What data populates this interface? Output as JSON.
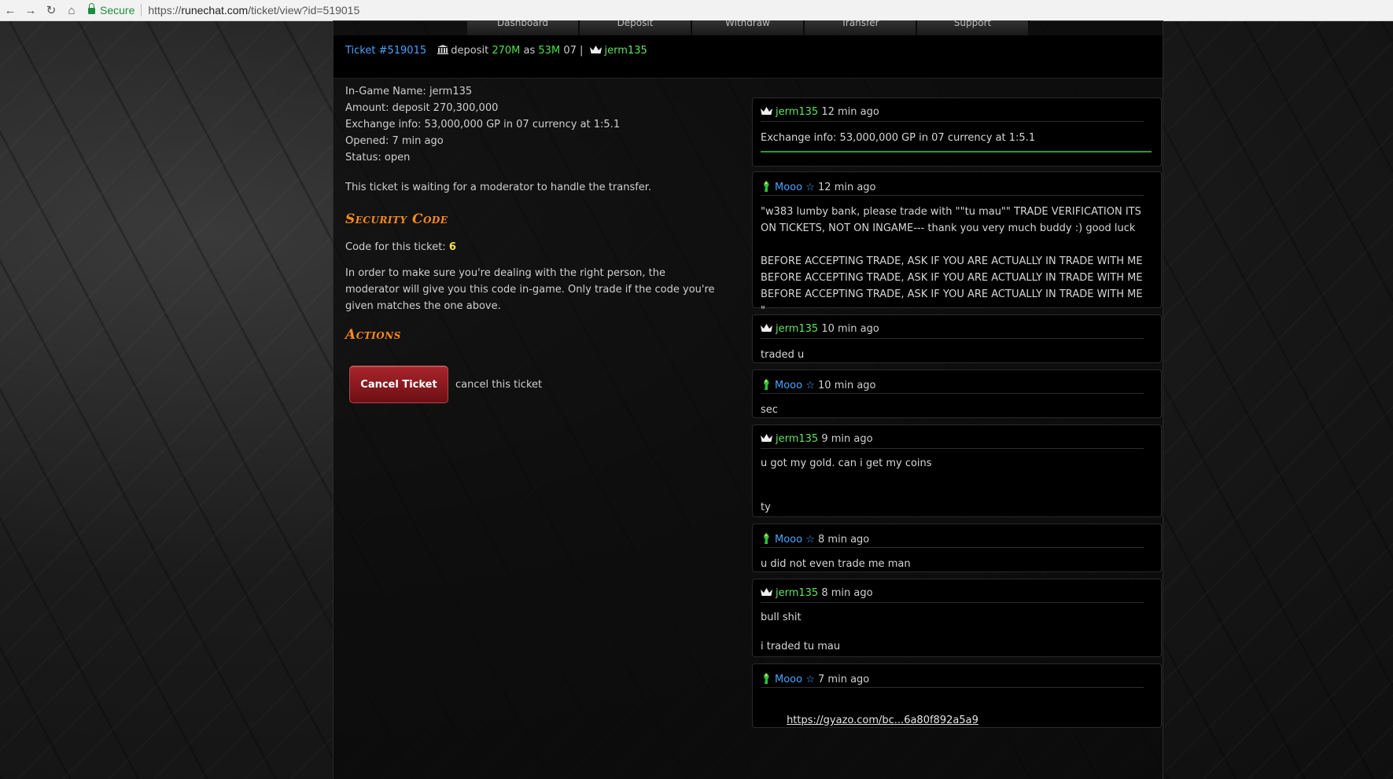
{
  "browser": {
    "secure_label": "Secure",
    "url_proto": "https://",
    "url_host": "runechat.com",
    "url_path": "/ticket/view?id=519015"
  },
  "nav": [
    "Dashboard",
    "Deposit",
    "Withdraw",
    "Transfer",
    "Support"
  ],
  "ticket_bar": {
    "ticket": "Ticket #519015",
    "type": "deposit",
    "amount": "270M",
    "as": "as",
    "converted": "53M",
    "currency": "07",
    "separator": "|",
    "user": "jerm135"
  },
  "details": {
    "ingame": "In-Game Name: jerm135",
    "amount": "Amount: deposit 270,300,000",
    "exchange": "Exchange info: 53,000,000 GP in 07 currency at 1:5.1",
    "opened": "Opened: 7 min ago",
    "status": "Status: open",
    "waiting": "This ticket is waiting for a moderator to handle the transfer."
  },
  "security": {
    "title": "Security Code",
    "code_label": "Code for this ticket:",
    "code_value": "6",
    "explanation": "In order to make sure you're dealing with the right person, the moderator will give you this code in-game. Only trade if the code you're given matches the one above."
  },
  "actions": {
    "title": "Actions",
    "cancel_button": "Cancel Ticket",
    "cancel_note": "cancel this ticket"
  },
  "messages": [
    {
      "author": "jerm135",
      "role": "user",
      "time": "12 min ago",
      "body": "Exchange info: 53,000,000 GP in 07 currency at 1:5.1"
    },
    {
      "author": "Mooo ☆",
      "role": "mod",
      "time": "12 min ago",
      "body": "\"w383 lumby bank, please trade with \"\"tu mau\"\" TRADE VERIFICATION ITS ON TICKETS, NOT ON INGAME--- thank you very much buddy :) good luck\n\nBEFORE ACCEPTING TRADE, ASK IF YOU ARE ACTUALLY IN TRADE WITH ME\nBEFORE ACCEPTING TRADE, ASK IF YOU ARE ACTUALLY IN TRADE WITH ME\nBEFORE ACCEPTING TRADE, ASK IF YOU ARE ACTUALLY IN TRADE WITH ME\n\""
    },
    {
      "author": "jerm135",
      "role": "user",
      "time": "10 min ago",
      "body": "traded u"
    },
    {
      "author": "Mooo ☆",
      "role": "mod",
      "time": "10 min ago",
      "body": "sec"
    },
    {
      "author": "jerm135",
      "role": "user",
      "time": "9 min ago",
      "body": "u got my gold. can i get my coins\n\n\nty"
    },
    {
      "author": "Mooo ☆",
      "role": "mod",
      "time": "8 min ago",
      "body": "u did not even trade me man"
    },
    {
      "author": "jerm135",
      "role": "user",
      "time": "8 min ago",
      "body": "bull shit\n\ni traded tu mau"
    },
    {
      "author": "Mooo ☆",
      "role": "mod",
      "time": "7 min ago",
      "body": "https://gyazo.com/bc...6a80f892a5a9"
    }
  ],
  "colors": {
    "user": "#5fe35f",
    "mod": "#4aa3ff",
    "accent": "#ff8a1a",
    "button": "#8e1a20"
  }
}
